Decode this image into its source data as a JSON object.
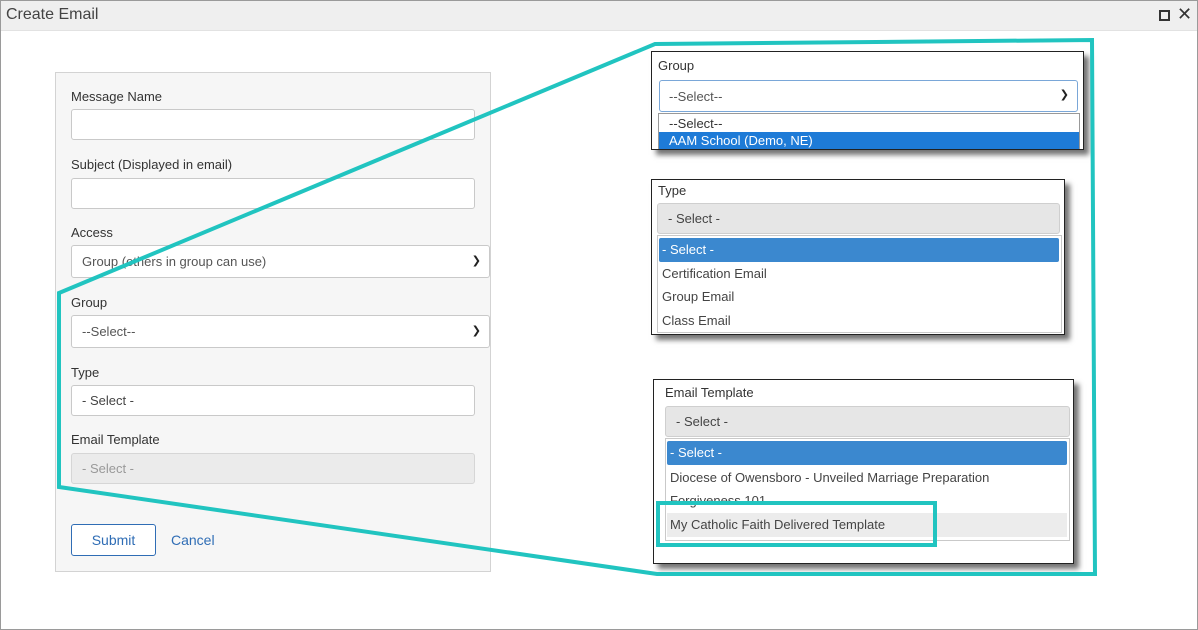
{
  "window": {
    "title": "Create Email"
  },
  "form": {
    "message_name_label": "Message Name",
    "message_name_value": "",
    "subject_label": "Subject (Displayed in email)",
    "subject_value": "",
    "access_label": "Access",
    "access_value": "Group (others in group can use)",
    "group_label": "Group",
    "group_value": "--Select--",
    "type_label": "Type",
    "type_value": "- Select -",
    "template_label": "Email Template",
    "template_value": "- Select -",
    "submit_label": "Submit",
    "cancel_label": "Cancel"
  },
  "callout_group": {
    "label": "Group",
    "selected": "--Select--",
    "options": [
      "--Select--",
      "AAM School (Demo, NE)"
    ]
  },
  "callout_type": {
    "label": "Type",
    "selected": "- Select -",
    "options": [
      "- Select -",
      "Certification Email",
      "Group Email",
      "Class Email"
    ]
  },
  "callout_template": {
    "label": "Email Template",
    "selected": "- Select -",
    "options": [
      "- Select -",
      "Diocese of Owensboro - Unveiled Marriage Preparation",
      "Forgiveness 101",
      "My Catholic Faith Delivered Template"
    ]
  },
  "colors": {
    "accent_teal": "#21c4c0",
    "link_blue": "#2f6db5",
    "highlight_blue": "#3b88cf"
  }
}
